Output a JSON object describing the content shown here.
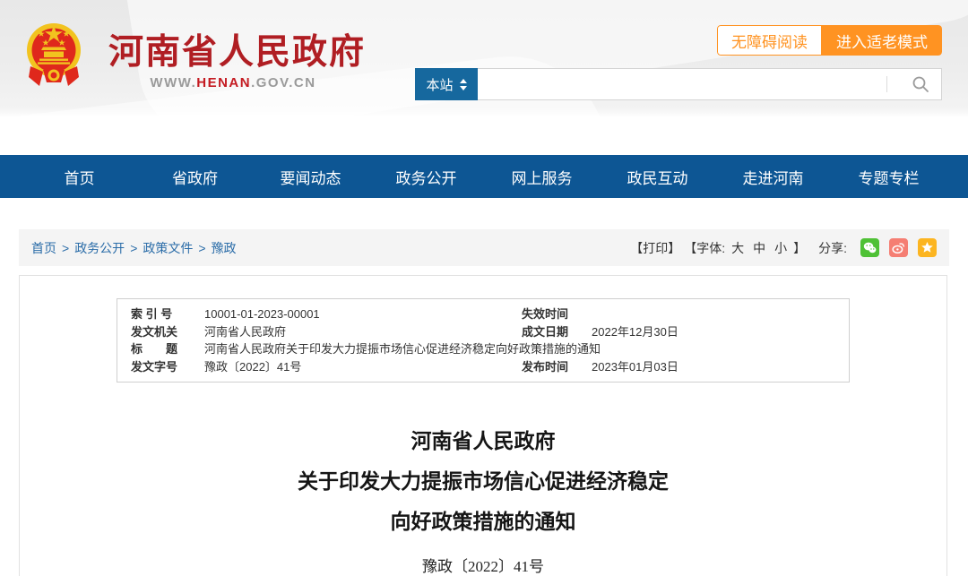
{
  "header": {
    "site_name": "河南省人民政府",
    "url_prefix": "WWW.",
    "url_highlight": "HENAN",
    "url_suffix": ".GOV.CN",
    "accessibility_button": "无障碍阅读",
    "elder_mode_button": "进入适老模式",
    "search_scope": "本站",
    "search_placeholder": ""
  },
  "nav": {
    "items": [
      "首页",
      "省政府",
      "要闻动态",
      "政务公开",
      "网上服务",
      "政民互动",
      "走进河南",
      "专题专栏"
    ]
  },
  "breadcrumb": {
    "separator": ">",
    "items": [
      "首页",
      "政务公开",
      "政策文件",
      "豫政"
    ]
  },
  "toolbar": {
    "print_label": "【打印】",
    "font_label_open": "【字体:",
    "font_large": "大",
    "font_medium": "中",
    "font_small": "小",
    "font_label_close": "】",
    "share_label": "分享:",
    "share_icons": [
      "wechat-icon",
      "weibo-icon",
      "star-icon"
    ]
  },
  "doc_meta": {
    "row1": {
      "label1": "索 引 号",
      "value1": "10001-01-2023-00001",
      "label2": "失效时间",
      "value2": ""
    },
    "row2": {
      "label1": "发文机关",
      "value1": "河南省人民政府",
      "label2": "成文日期",
      "value2": "2022年12月30日"
    },
    "row3": {
      "label1": "标　　题",
      "value1": "河南省人民政府关于印发大力提振市场信心促进经济稳定向好政策措施的通知"
    },
    "row4": {
      "label1": "发文字号",
      "value1": "豫政〔2022〕41号",
      "label2": "发布时间",
      "value2": "2023年01月03日"
    }
  },
  "document": {
    "title_line1": "河南省人民政府",
    "title_line2": "关于印发大力提振市场信心促进经济稳定",
    "title_line3": "向好政策措施的通知",
    "doc_number": "豫政〔2022〕41号"
  },
  "colors": {
    "nav_blue": "#0d5694",
    "scope_blue": "#16689e",
    "accent_orange": "#ff9322",
    "title_red": "#b01e23",
    "url_red": "#c41a21",
    "breadcrumb_blue": "#2a6ca8",
    "wechat_green": "#4fc136",
    "weibo_red": "#f57e73",
    "star_orange": "#fcb521",
    "emblem_gold": "#f2c31f",
    "emblem_red": "#df281c"
  }
}
